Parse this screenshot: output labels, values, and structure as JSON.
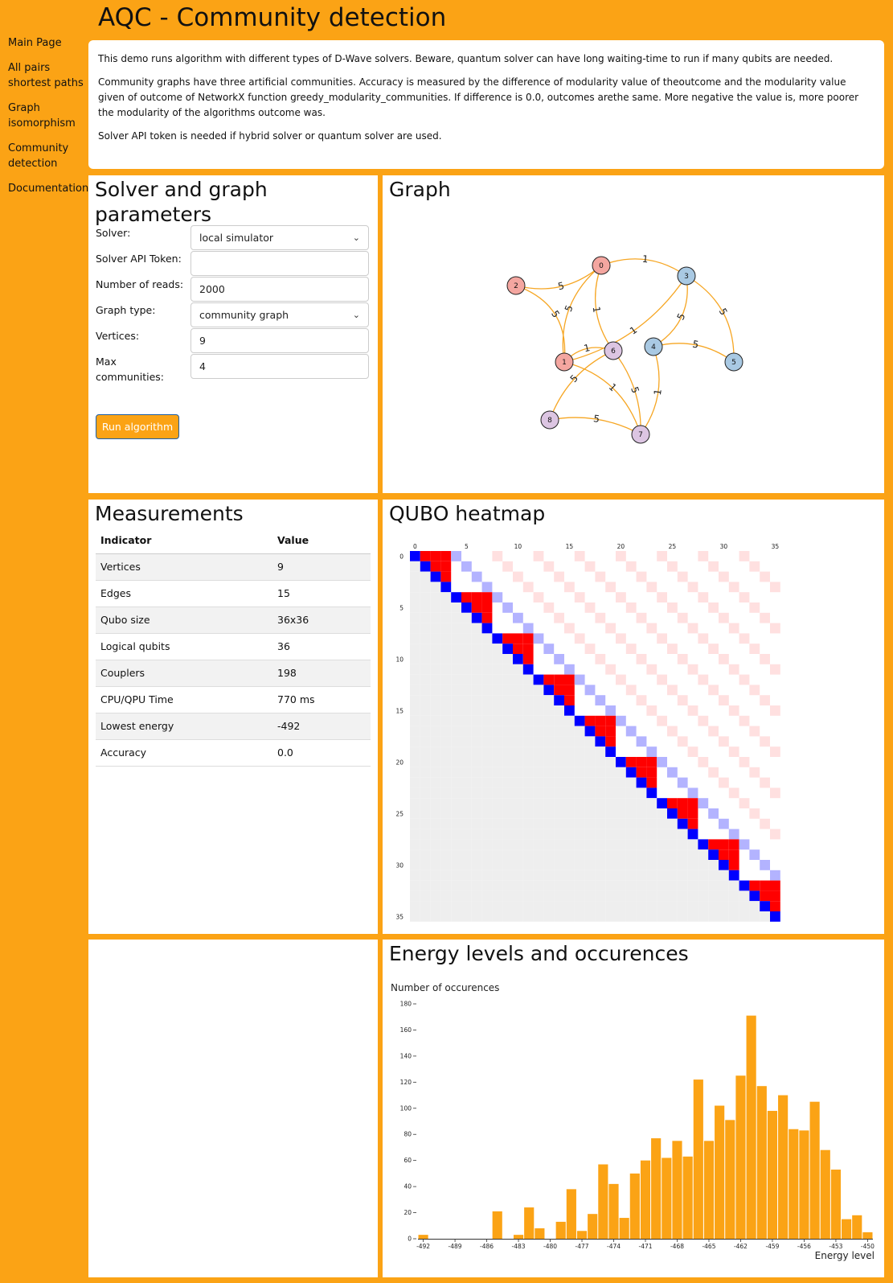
{
  "app_title": "AQC - Community detection",
  "nav": [
    {
      "label": "Main Page",
      "name": "nav-main-page"
    },
    {
      "label": "All pairs shortest paths",
      "name": "nav-all-pairs-shortest-paths"
    },
    {
      "label": "Graph isomorphism",
      "name": "nav-graph-isomorphism"
    },
    {
      "label": "Community detection",
      "name": "nav-community-detection"
    },
    {
      "label": "Documentation",
      "name": "nav-documentation"
    }
  ],
  "intro": {
    "p1": "This demo runs algorithm with different types of D-Wave solvers. Beware, quantum solver can have long waiting-time to run if many qubits are needed.",
    "p2": "Community graphs have three artificial communities. Accuracy is measured by the difference of modularity value of theoutcome and the modularity value given of outcome of NetworkX function greedy_modularity_communities. If difference is 0.0, outcomes arethe same. More negative the value is, more poorer the modularity of the algorithms outcome was.",
    "p3": "Solver API token is needed if hybrid solver or quantum solver are used."
  },
  "params": {
    "title": "Solver and graph parameters",
    "solver_label": "Solver:",
    "solver_value": "local simulator",
    "token_label": "Solver API Token:",
    "token_value": "",
    "reads_label": "Number of reads:",
    "reads_value": "2000",
    "graph_type_label": "Graph type:",
    "graph_type_value": "community graph",
    "vertices_label": "Vertices:",
    "vertices_value": "9",
    "max_comm_label": "Max communities:",
    "max_comm_value": "4",
    "run_label": "Run algorithm"
  },
  "graph": {
    "title": "Graph",
    "community_colors": {
      "a": "#f4a6a0",
      "b": "#a9c9e3",
      "c": "#dcc5e2"
    },
    "nodes": [
      {
        "id": "0",
        "community": "a"
      },
      {
        "id": "1",
        "community": "a"
      },
      {
        "id": "2",
        "community": "a"
      },
      {
        "id": "3",
        "community": "b"
      },
      {
        "id": "4",
        "community": "b"
      },
      {
        "id": "5",
        "community": "b"
      },
      {
        "id": "6",
        "community": "c"
      },
      {
        "id": "7",
        "community": "c"
      },
      {
        "id": "8",
        "community": "c"
      }
    ],
    "edges": [
      {
        "u": "0",
        "v": "2",
        "w": "5"
      },
      {
        "u": "0",
        "v": "3",
        "w": "1"
      },
      {
        "u": "0",
        "v": "1",
        "w": "5"
      },
      {
        "u": "0",
        "v": "6",
        "w": "1"
      },
      {
        "u": "1",
        "v": "2",
        "w": "5"
      },
      {
        "u": "1",
        "v": "6",
        "w": "1"
      },
      {
        "u": "1",
        "v": "3",
        "w": "1"
      },
      {
        "u": "1",
        "v": "7",
        "w": "1"
      },
      {
        "u": "3",
        "v": "4",
        "w": "5"
      },
      {
        "u": "3",
        "v": "5",
        "w": "5"
      },
      {
        "u": "4",
        "v": "5",
        "w": "5"
      },
      {
        "u": "4",
        "v": "7",
        "w": "1"
      },
      {
        "u": "6",
        "v": "8",
        "w": "5"
      },
      {
        "u": "6",
        "v": "7",
        "w": "5"
      },
      {
        "u": "7",
        "v": "8",
        "w": "5"
      }
    ]
  },
  "measurements": {
    "title": "Measurements",
    "col_indicator": "Indicator",
    "col_value": "Value",
    "rows": [
      {
        "indicator": "Vertices",
        "value": "9"
      },
      {
        "indicator": "Edges",
        "value": "15"
      },
      {
        "indicator": "Qubo size",
        "value": "36x36"
      },
      {
        "indicator": "Logical qubits",
        "value": "36"
      },
      {
        "indicator": "Couplers",
        "value": "198"
      },
      {
        "indicator": "CPU/QPU Time",
        "value": "770 ms"
      },
      {
        "indicator": "Lowest energy",
        "value": "-492"
      },
      {
        "indicator": "Accuracy",
        "value": "0.0"
      }
    ]
  },
  "heatmap": {
    "title": "QUBO heatmap",
    "size": 36,
    "groups": 9,
    "communities_per_group": 4,
    "tick_labels": [
      "0",
      "5",
      "10",
      "15",
      "20",
      "25",
      "30",
      "35"
    ],
    "colors": {
      "diag": "#0000ff",
      "block": "#ff0000",
      "same_comm": "#b3b3ff",
      "cross": "#ffe0e0",
      "lower": "#eeeeee"
    }
  },
  "chart_data": {
    "type": "bar",
    "title": "Energy levels and occurences",
    "ylabel": "Number of occurences",
    "xlabel": "Energy level",
    "bar_color": "#fba315",
    "xlim": [
      -492.5,
      -449.5
    ],
    "ylim": [
      0,
      180
    ],
    "x_ticks": [
      -492,
      -489,
      -486,
      -483,
      -480,
      -477,
      -474,
      -471,
      -468,
      -465,
      -462,
      -459,
      -456,
      -453,
      -450
    ],
    "y_ticks": [
      0,
      20,
      40,
      60,
      80,
      100,
      120,
      140,
      160,
      180
    ],
    "x": [
      -492,
      -491,
      -490,
      -489,
      -488,
      -487,
      -486,
      -485,
      -484,
      -483,
      -482,
      -481,
      -480,
      -479,
      -478,
      -477,
      -476,
      -475,
      -474,
      -473,
      -472,
      -471,
      -470,
      -469,
      -468,
      -467,
      -466,
      -465,
      -464,
      -463,
      -462,
      -461,
      -460,
      -459,
      -458,
      -457,
      -456,
      -455,
      -454,
      -453,
      -452,
      -451,
      -450
    ],
    "values": [
      3,
      0,
      0,
      0,
      0,
      0,
      0,
      21,
      0,
      3,
      24,
      8,
      0,
      13,
      38,
      6,
      19,
      57,
      42,
      16,
      50,
      60,
      77,
      62,
      75,
      63,
      122,
      75,
      102,
      91,
      125,
      171,
      117,
      98,
      110,
      84,
      83,
      105,
      68,
      53,
      15,
      18,
      5
    ]
  }
}
